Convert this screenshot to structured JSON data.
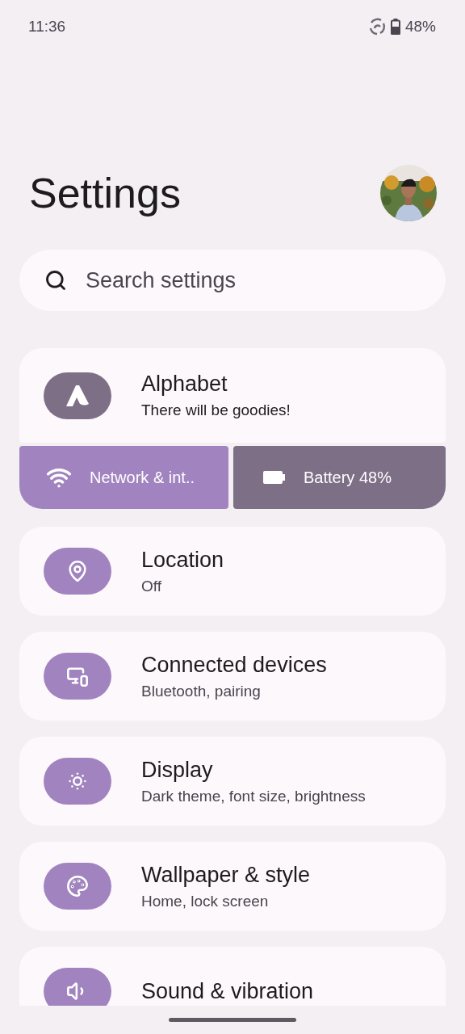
{
  "status_bar": {
    "time": "11:36",
    "battery": "48%"
  },
  "title": "Settings",
  "search": {
    "placeholder": "Search settings"
  },
  "account": {
    "title": "Alphabet",
    "subtitle": "There will be goodies!"
  },
  "tiles": [
    {
      "kind": "network",
      "label": "Network & int..",
      "color": "#a184bf"
    },
    {
      "kind": "battery",
      "label": "Battery 48%",
      "color": "#7d6f86"
    }
  ],
  "items": [
    {
      "kind": "location",
      "title": "Location",
      "subtitle": "Off"
    },
    {
      "kind": "devices",
      "title": "Connected devices",
      "subtitle": "Bluetooth, pairing"
    },
    {
      "kind": "display",
      "title": "Display",
      "subtitle": "Dark theme, font size, brightness"
    },
    {
      "kind": "wallpaper",
      "title": "Wallpaper & style",
      "subtitle": "Home, lock screen"
    },
    {
      "kind": "sound",
      "title": "Sound & vibration"
    }
  ]
}
